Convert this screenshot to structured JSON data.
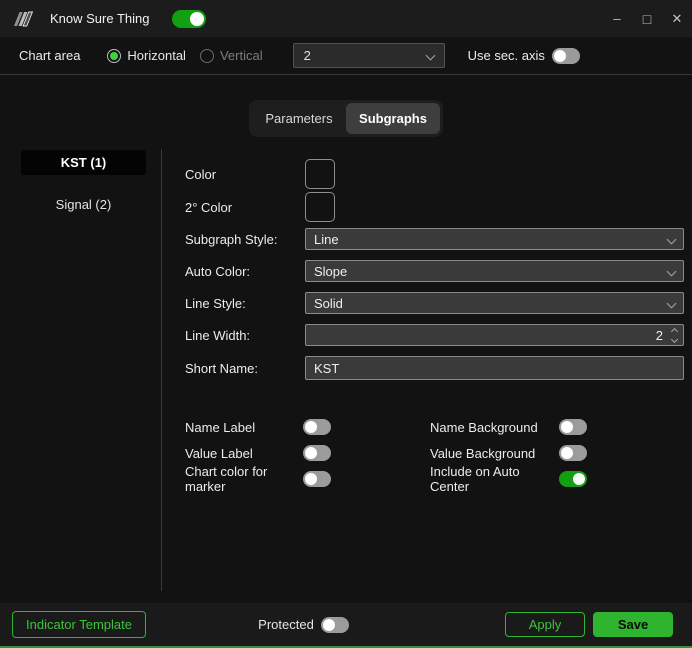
{
  "window": {
    "title": "Know Sure Thing",
    "enabled_toggle_on": true,
    "icons": {
      "minimize": "–",
      "maximize": "□",
      "close": "✕"
    }
  },
  "toolbar": {
    "chart_area_label": "Chart area",
    "orientation": {
      "horizontal_label": "Horizontal",
      "vertical_label": "Vertical",
      "selected": "Horizontal"
    },
    "chart_area_select": {
      "value": "2"
    },
    "use_sec_axis": {
      "label": "Use sec. axis",
      "on": false
    }
  },
  "tabs": {
    "parameters_label": "Parameters",
    "subgraphs_label": "Subgraphs",
    "active": "Subgraphs"
  },
  "sidebar": {
    "items": [
      {
        "label": "KST (1)",
        "active": true
      },
      {
        "label": "Signal (2)",
        "active": false
      }
    ]
  },
  "panel": {
    "color": {
      "label": "Color",
      "value": "#5ed35e"
    },
    "secondary_color": {
      "label": "2° Color",
      "value": "#a57cc3"
    },
    "subgraph_style": {
      "label": "Subgraph Style:",
      "value": "Line"
    },
    "auto_color": {
      "label": "Auto Color:",
      "value": "Slope"
    },
    "line_style": {
      "label": "Line Style:",
      "value": "Solid"
    },
    "line_width": {
      "label": "Line Width:",
      "value": "2"
    },
    "short_name": {
      "label": "Short Name:",
      "value": "KST"
    },
    "toggle_rows": [
      {
        "left": {
          "label": "Name Label",
          "on": false
        },
        "right": {
          "label": "Name Background",
          "on": false
        }
      },
      {
        "left": {
          "label": "Value Label",
          "on": false
        },
        "right": {
          "label": "Value Background",
          "on": false
        }
      },
      {
        "left": {
          "label": "Chart color for marker",
          "on": false
        },
        "right": {
          "label": "Include on Auto Center",
          "on": true
        }
      }
    ]
  },
  "footer": {
    "indicator_template_label": "Indicator Template",
    "protected": {
      "label": "Protected",
      "on": false
    },
    "apply_label": "Apply",
    "save_label": "Save"
  },
  "colors": {
    "accent_green": "#2eb42e",
    "toggle_on_green": "#12a012",
    "window_bottom_border": "#3a8f3e"
  }
}
